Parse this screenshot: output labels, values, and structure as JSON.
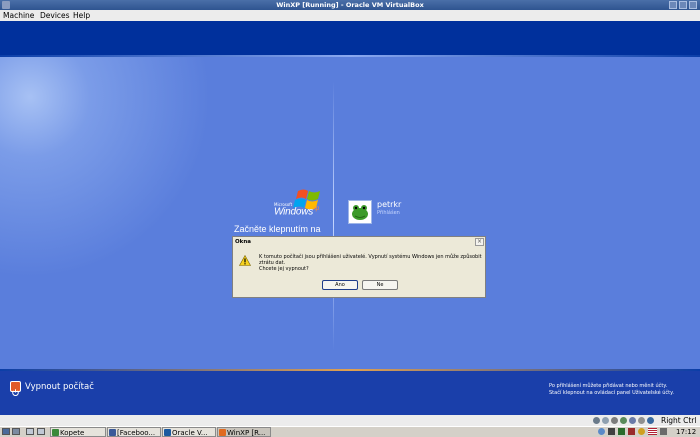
{
  "host": {
    "title": "WinXP [Running] - Oracle VM VirtualBox",
    "menu": [
      "Machine",
      "Devices",
      "Help"
    ],
    "host_key": "Right Ctrl"
  },
  "guest": {
    "logo_small": "Microsoft",
    "logo_text": "Windows",
    "logo_xp": "xp",
    "welcome": "Začněte klepnutím na",
    "user": {
      "name": "petrkr",
      "status": "Přihlášen"
    },
    "shutdown_label": "Vypnout počítač",
    "hint_line1": "Po přihlášení můžete přidávat nebo měnit účty.",
    "hint_line2": "Stačí klepnout na ovládací panel Uživatelské účty."
  },
  "dialog": {
    "title": "Okna",
    "close": "×",
    "message": "K tomuto počítači jsou přihlášeni uživatelé. Vypnutí systému Windows jen může způsobit ztrátu dat.",
    "question": "Chcete jej vypnout?",
    "yes": "Ano",
    "no": "Ne"
  },
  "taskbar": {
    "tasks": [
      "Kopete",
      "[Faceboo...",
      "Oracle V...",
      "WinXP [R..."
    ],
    "clock": "17:12"
  },
  "colors": {
    "guest_blue": "#5a7edc",
    "band_blue": "#00309c",
    "dialog_bg": "#ece9d8"
  }
}
